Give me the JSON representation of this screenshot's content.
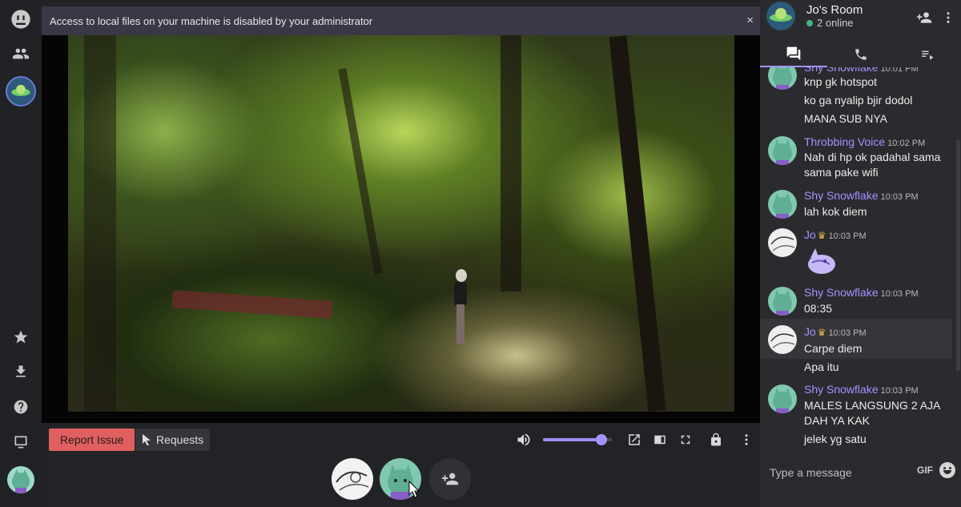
{
  "banner": {
    "text": "Access to local files on your machine is disabled by your administrator",
    "close": "×"
  },
  "controls": {
    "report_label": "Report Issue",
    "requests_label": "Requests",
    "volume_level": 0.85
  },
  "room": {
    "title": "Jo's Room",
    "status": "2 online"
  },
  "chat": {
    "messages": [
      {
        "author": "Shy Snowflake",
        "time": "10:01 PM",
        "lines": [
          "knp gk hotspot",
          "ko ga nyalip bjir dodol",
          "MANA SUB NYA"
        ]
      },
      {
        "author": "Throbbing Voice",
        "time": "10:02 PM",
        "lines": [
          "Nah di hp ok padahal sama sama pake wifi"
        ]
      },
      {
        "author": "Shy Snowflake",
        "time": "10:03 PM",
        "lines": [
          "lah kok diem"
        ]
      },
      {
        "author": "Jo",
        "time": "10:03 PM",
        "lines": []
      },
      {
        "author": "Shy Snowflake",
        "time": "10:03 PM",
        "lines": [
          "08:35"
        ]
      },
      {
        "author": "Jo",
        "time": "10:03 PM",
        "lines": [
          "Carpe diem",
          "Apa itu"
        ]
      },
      {
        "author": "Shy Snowflake",
        "time": "10:03 PM",
        "lines": [
          "MALES LANGSUNG 2 AJA DAH YA KAK",
          "jelek yg satu"
        ]
      }
    ],
    "placeholder": "Type a message",
    "gif_label": "GIF"
  },
  "icons": {
    "rail": [
      "home-icon",
      "friends-icon",
      "room-avatar",
      "star-icon",
      "download-icon",
      "help-icon",
      "screen-icon",
      "user-avatar"
    ],
    "controls": [
      "volume-icon",
      "popout-icon",
      "theater-icon",
      "fullscreen-icon",
      "lock-icon",
      "more-icon"
    ],
    "header": [
      "add-user-icon",
      "more-icon"
    ],
    "tabs": [
      "chat-icon",
      "phone-icon",
      "playlist-icon"
    ]
  },
  "colors": {
    "accent": "#a293ff",
    "report": "#e06060",
    "online": "#43b581"
  }
}
